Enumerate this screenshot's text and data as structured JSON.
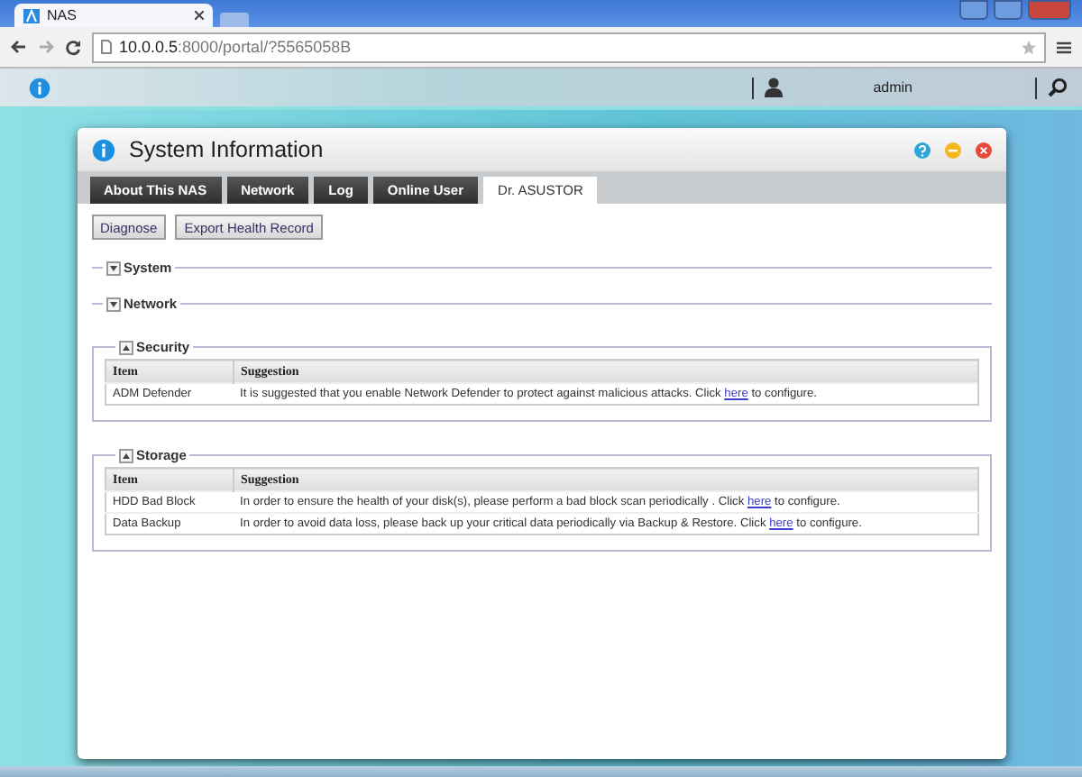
{
  "browser": {
    "tab_title": "NAS",
    "url_host": "10.0.0.5",
    "url_rest": ":8000/portal/?5565058B"
  },
  "portal": {
    "user": "admin"
  },
  "window": {
    "title": "System Information"
  },
  "tabs": [
    {
      "label": "About This NAS",
      "selected": false
    },
    {
      "label": "Network",
      "selected": false
    },
    {
      "label": "Log",
      "selected": false
    },
    {
      "label": "Online User",
      "selected": false
    },
    {
      "label": "Dr. ASUSTOR",
      "selected": true
    }
  ],
  "buttons": [
    "Diagnose",
    "Export Health Record"
  ],
  "sections": [
    {
      "title": "System",
      "expanded": false
    },
    {
      "title": "Network",
      "expanded": false
    },
    {
      "title": "Security",
      "expanded": true,
      "columns": [
        "Item",
        "Suggestion"
      ],
      "rows": [
        {
          "item": "ADM Defender",
          "before": "It is suggested that you enable Network Defender to protect against malicious attacks. Click",
          "link": "here",
          "after": "to configure."
        }
      ]
    },
    {
      "title": "Storage",
      "expanded": true,
      "columns": [
        "Item",
        "Suggestion"
      ],
      "rows": [
        {
          "item": "HDD Bad Block",
          "before": "In order to ensure the health of your disk(s), please perform a bad block scan periodically . Click",
          "link": "here",
          "after": "to configure."
        },
        {
          "item": "Data Backup",
          "before": "In order to avoid data loss, please back up your critical data periodically via Backup & Restore. Click",
          "link": "here",
          "after": "to configure."
        }
      ]
    }
  ]
}
